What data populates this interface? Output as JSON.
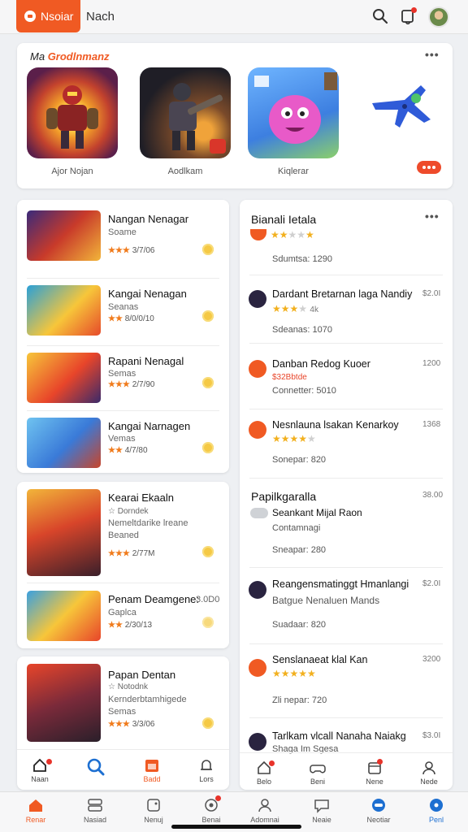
{
  "header": {
    "logo_text": "Nsoiar",
    "title": "Nach"
  },
  "featured": {
    "title_plain": "Ma",
    "title_accent": "Grodlnmanz",
    "items": [
      {
        "label": "Ajor Nojan",
        "art": "hero-red-robot"
      },
      {
        "label": "Aodlkam",
        "art": "dark-armor-gunner"
      },
      {
        "label": "Kiqlerar",
        "art": "pink-blob-monster"
      },
      {
        "label": "",
        "art": "blue-jet-plane"
      }
    ]
  },
  "left_list_a": [
    {
      "title": "Nangan Nenagar",
      "sub": "Soame",
      "rate_stars": "★★★",
      "rate_text": "3/7/06"
    },
    {
      "title": "Kangai Nenagan",
      "sub": "Seanas",
      "rate_stars": "★★",
      "rate_text": "8/0/0/10"
    },
    {
      "title": "Rapani Nenagal",
      "sub": "Semas",
      "rate_stars": "★★★",
      "rate_text": "2/7/90"
    },
    {
      "title": "Kangai Narnagen",
      "sub": "Vemas",
      "rate_stars": "★★",
      "rate_text": "4/7/80"
    }
  ],
  "left_list_b": [
    {
      "title": "Kearai Ekaaln",
      "sub": "☆ Dorndek",
      "desc": "Nemeltdarike lreane",
      "sub2": "Beaned",
      "rate_stars": "★★★",
      "rate_text": "2/77M"
    },
    {
      "title": "Penam Deamgene:",
      "value": "3.0D0",
      "sub": "Gaplca",
      "rate_stars": "★★",
      "rate_text": "2/30/13"
    }
  ],
  "left_list_c": [
    {
      "title": "Papan Dentan",
      "sub": "☆ Notodnk",
      "desc": "Kernderbtamhigede",
      "sub2": "Semas",
      "rate_stars": "★★★",
      "rate_text": "3/3/06"
    }
  ],
  "left_nav": [
    {
      "label": "Naan",
      "icon": "home-icon"
    },
    {
      "label": "",
      "icon": "search-icon"
    },
    {
      "label": "Badd",
      "icon": "calendar-icon"
    },
    {
      "label": "Lors",
      "icon": "bell-icon"
    }
  ],
  "right_panel": {
    "title": "Bianali Ietala",
    "subtitle": "Sdumtsa: 1290",
    "items": [
      {
        "title": "Dardant Bretarnan laga Nandiy",
        "value": "$2.0I",
        "stars": 3,
        "star_text": "4k",
        "meta": "Sdeanas: 1070"
      },
      {
        "title": "Danban Redog Kuoer",
        "value": "1200",
        "sub": "$32Bbtde",
        "meta": "Connetter: 5010"
      },
      {
        "title": "Nesnlauna lsakan Kenarkoy",
        "value": "1368",
        "stars": 4,
        "meta": "Sonepar: 820"
      }
    ],
    "section2_title": "Papilkgaralla",
    "section2_value": "38.00",
    "section2_lead_title": "Seankant Mijal Raon",
    "section2_lead_sub": "Contamnagi",
    "section2_lead_meta": "Sneapar: 280",
    "items2": [
      {
        "title": "Reangensmatinggt Hmanlangi",
        "value": "$2.0I",
        "sub": "Batgue Nenaluen Mands",
        "meta": "Suadaar: 820"
      },
      {
        "title": "Senslanaeat klal Kan",
        "value": "3200",
        "stars": 5,
        "meta": "Zli nepar: 720"
      },
      {
        "title": "Tarlkam vlcall Nanaha Naiakg",
        "value": "$3.0I",
        "sub": "Shaga Im Sgesa"
      }
    ]
  },
  "right_nav": [
    {
      "label": "Belo",
      "icon": "home-icon"
    },
    {
      "label": "Beni",
      "icon": "gamepad-icon"
    },
    {
      "label": "Nene",
      "icon": "calendar-icon"
    },
    {
      "label": "Nede",
      "icon": "user-icon"
    }
  ],
  "bottom_nav": [
    {
      "label": "Renar",
      "icon": "home-icon"
    },
    {
      "label": "Nasiad",
      "icon": "grid-icon"
    },
    {
      "label": "Nenuj",
      "icon": "controller-icon"
    },
    {
      "label": "Benai",
      "icon": "bell-icon"
    },
    {
      "label": "Adomnai",
      "icon": "user-icon"
    },
    {
      "label": "Neaie",
      "icon": "chat-icon"
    },
    {
      "label": "Neotiar",
      "icon": "globe-icon"
    },
    {
      "label": "Penl",
      "icon": "compass-icon"
    }
  ],
  "colors": {
    "accent": "#f05a23",
    "star": "#f2b01e",
    "red": "#e8332a",
    "nav_active": "#1d6fd1"
  }
}
